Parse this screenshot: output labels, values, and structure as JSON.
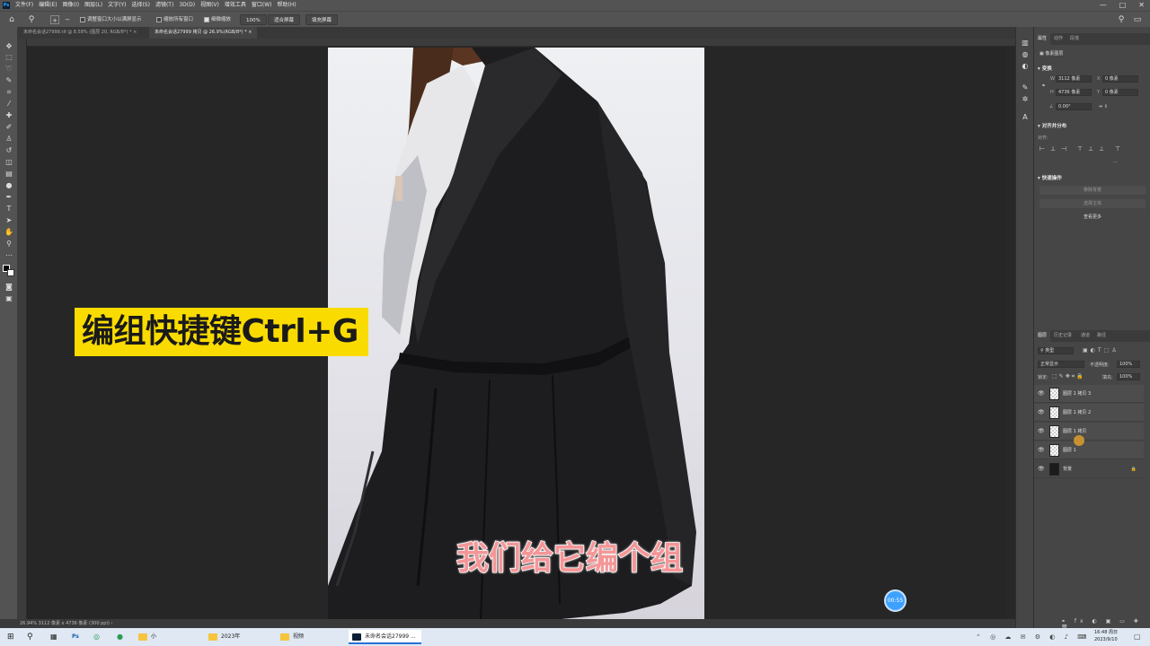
{
  "menubar": {
    "logo": "Ps",
    "items": [
      "文件(F)",
      "编辑(E)",
      "图像(I)",
      "图层(L)",
      "文字(Y)",
      "选择(S)",
      "滤镜(T)",
      "3D(D)",
      "视图(V)",
      "增效工具",
      "窗口(W)",
      "帮助(H)"
    ],
    "minimize": "—",
    "maximize": "□",
    "close": "✕"
  },
  "options": {
    "resize_windows": "调整窗口大小以满屏显示",
    "zoom_all": "缩放所有窗口",
    "scrubby_zoom": "细微缩放",
    "zoom_value": "100%",
    "fit_screen": "适合屏幕",
    "fill_screen": "填充屏幕"
  },
  "tabs": [
    {
      "label": "未命名会话27998.tif @ 8.58% (图层 20, RGB/8*) *  ×"
    },
    {
      "label": "未命名会话27999 拷贝 @ 26.9%(RGB/8*) *  ×"
    }
  ],
  "canvas": {
    "caption": "编组快捷键Ctrl+G",
    "subtitle": "我们给它编个组",
    "timer": "00:55"
  },
  "status": {
    "text": "26.94%   3112 像素 x 4736 像素 (300 ppi)   ›"
  },
  "properties": {
    "tabs": [
      "属性",
      "动作",
      "段落"
    ],
    "pixel_layer": "像素图层",
    "transform_title": "变换",
    "w_label": "W",
    "w_value": "3112 像素",
    "x_label": "X",
    "x_value": "0 像素",
    "h_label": "H",
    "h_value": "4736 像素",
    "y_label": "Y",
    "y_value": "0 像素",
    "angle_value": "0.00°",
    "align_title": "对齐并分布",
    "align_to": "对齐:",
    "quick_title": "快速操作",
    "remove_bg": "移除背景",
    "select_subject": "选择主体",
    "more": "查看更多"
  },
  "layers": {
    "tabs": [
      "图层",
      "历史记录",
      "通道",
      "路径"
    ],
    "filter_kind": "类型",
    "blend_mode": "正常显示",
    "opacity_label": "不透明度:",
    "opacity_value": "100%",
    "lock_label": "锁定:",
    "fill_label": "填充:",
    "fill_value": "100%",
    "items": [
      {
        "name": "图层 1 拷贝 3"
      },
      {
        "name": "图层 1 拷贝 2"
      },
      {
        "name": "图层 1 拷贝"
      },
      {
        "name": "图层 1"
      },
      {
        "name": "背景"
      }
    ]
  },
  "taskbar": {
    "apps": [
      {
        "label": "小"
      },
      {
        "label": "2023年"
      },
      {
        "label": "视频"
      },
      {
        "label": "未命名会话27999 ..."
      }
    ],
    "time": "16:48 周日",
    "date": "2023/9/10"
  }
}
